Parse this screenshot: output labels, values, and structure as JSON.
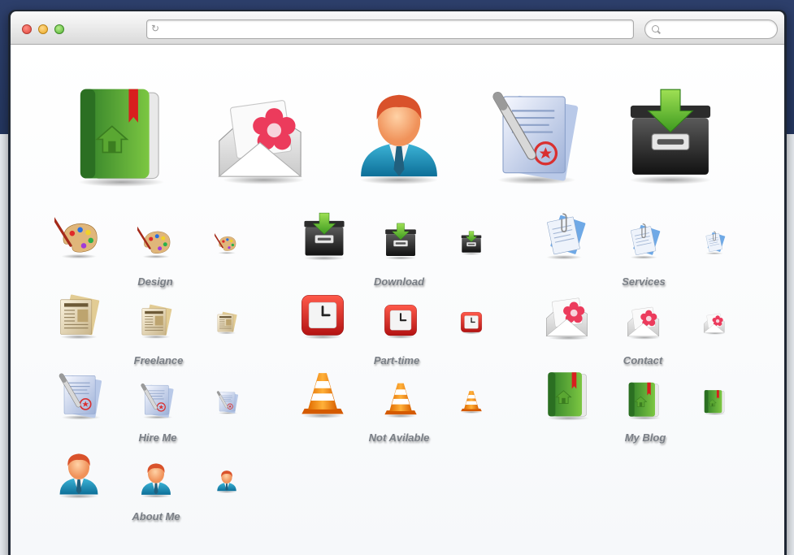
{
  "browser": {
    "address_value": "",
    "search_value": "",
    "traffic_lights": [
      "close",
      "minimize",
      "zoom"
    ]
  },
  "hero_icons": [
    "address-book-icon",
    "love-mail-icon",
    "user-icon",
    "contract-icon",
    "inbox-download-icon"
  ],
  "icon_groups": [
    {
      "label": "Design",
      "icon": "palette-icon"
    },
    {
      "label": "Download",
      "icon": "inbox-download-icon"
    },
    {
      "label": "Services",
      "icon": "documents-icon"
    },
    {
      "label": "Freelance",
      "icon": "newspaper-icon"
    },
    {
      "label": "Part-time",
      "icon": "clock-icon"
    },
    {
      "label": "Contact",
      "icon": "love-mail-icon"
    },
    {
      "label": "Hire Me",
      "icon": "contract-icon"
    },
    {
      "label": "Not Avilable",
      "icon": "traffic-cone-icon"
    },
    {
      "label": "My Blog",
      "icon": "address-book-icon"
    },
    {
      "label": "About Me",
      "icon": "user-icon"
    }
  ],
  "colors": {
    "background_top": "#24365f",
    "label_text": "#7a7f86"
  }
}
